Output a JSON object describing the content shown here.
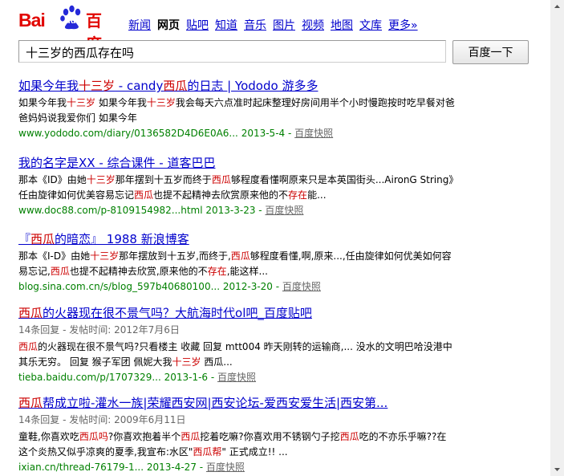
{
  "logo": {
    "bai": "Bai",
    "du": "du",
    "cn": "百度"
  },
  "nav": [
    {
      "label": "新闻",
      "current": false
    },
    {
      "label": "网页",
      "current": true
    },
    {
      "label": "贴吧",
      "current": false
    },
    {
      "label": "知道",
      "current": false
    },
    {
      "label": "音乐",
      "current": false
    },
    {
      "label": "图片",
      "current": false
    },
    {
      "label": "视频",
      "current": false
    },
    {
      "label": "地图",
      "current": false
    },
    {
      "label": "文库",
      "current": false
    },
    {
      "label": "更多»",
      "current": false
    }
  ],
  "search": {
    "value": "十三岁的西瓜存在吗",
    "button": "百度一下"
  },
  "results": [
    {
      "title": [
        [
          "如果今年我",
          false
        ],
        [
          "十三岁",
          true
        ],
        [
          " - candy",
          false
        ],
        [
          "西瓜",
          true
        ],
        [
          "的日志 | Yododo 游多多",
          false
        ]
      ],
      "abstract": [
        [
          "如果今年我",
          false
        ],
        [
          "十三岁",
          true
        ],
        [
          " 如果今年我",
          false
        ],
        [
          "十三岁",
          true
        ],
        [
          "我会每天六点准时起床整理好房间用半个小时慢跑按时吃早餐对爸爸妈妈说我爱你们 如果今年",
          false
        ]
      ],
      "meta": "",
      "url": "www.yododo.com/diary/0136582D4D6E0A6... 2013-5-4 - ",
      "snapshot": "百度快照"
    },
    {
      "title": [
        [
          "我的名字是XX - 综合课件 - 道客巴巴",
          false
        ]
      ],
      "abstract": [
        [
          "那本《ID》由她",
          false
        ],
        [
          "十三岁",
          true
        ],
        [
          "那年摆到十五岁而终于",
          false
        ],
        [
          "西瓜",
          true
        ],
        [
          "够程度看懂啊原来只是本英国街头...AironG String》任由旋律如何优美容易忘记",
          false
        ],
        [
          "西瓜",
          true
        ],
        [
          "也提不起精神去欣赏原来他的不",
          false
        ],
        [
          "存在",
          true
        ],
        [
          "能...",
          false
        ]
      ],
      "meta": "",
      "url": "www.doc88.com/p-8109154982...html 2013-3-23 - ",
      "snapshot": "百度快照"
    },
    {
      "title": [
        [
          "『",
          false
        ],
        [
          "西瓜",
          true
        ],
        [
          "的暗恋』 1988 新浪博客",
          false
        ]
      ],
      "abstract": [
        [
          "那本《I-D》由她",
          false
        ],
        [
          "十三岁",
          true
        ],
        [
          "那年摆放到十五岁,而终于,",
          false
        ],
        [
          "西瓜",
          true
        ],
        [
          "够程度看懂,啊,原来...,任由旋律如何优美如何容易忘记,",
          false
        ],
        [
          "西瓜",
          true
        ],
        [
          "也提不起精神去欣赏,原来他的不",
          false
        ],
        [
          "存在",
          true
        ],
        [
          ",能这样...",
          false
        ]
      ],
      "meta": "",
      "url": "blog.sina.com.cn/s/blog_597b40680100... 2012-3-20 - ",
      "snapshot": "百度快照"
    },
    {
      "title": [
        [
          "西瓜",
          true
        ],
        [
          "的火器现在很不景气吗？大航海时代ol吧_百度贴吧",
          false
        ]
      ],
      "abstract": [
        [
          "西瓜",
          true
        ],
        [
          "的火器现在很不景气吗?只看楼主 收藏 回复 mtt004 昨天刚转的运输商,... 没水的文明巴哈没港中 其乐无穷。 回复 猴子军团 佩妮大我",
          false
        ],
        [
          "十三岁",
          true
        ],
        [
          " 西瓜...",
          false
        ]
      ],
      "meta": "14条回复 - 发帖时间: 2012年7月6日",
      "url": "tieba.baidu.com/p/1707329... 2013-1-6 - ",
      "snapshot": "百度快照"
    },
    {
      "title": [
        [
          "西瓜",
          true
        ],
        [
          "帮成立啦-灌水一族|荣耀西安网|西安论坛-爱西安爱生活|西安第...",
          false
        ]
      ],
      "abstract": [
        [
          "童鞋,你喜欢吃",
          false
        ],
        [
          "西瓜吗",
          true
        ],
        [
          "?你喜欢抱着半个",
          false
        ],
        [
          "西瓜",
          true
        ],
        [
          "挖着吃嘛?你喜欢用不锈钢勺子挖",
          false
        ],
        [
          "西瓜",
          true
        ],
        [
          "吃的不亦乐乎嘛??在这个炎热又似乎凉爽的夏季,我宣布:水区\"",
          false
        ],
        [
          "西瓜帮",
          true
        ],
        [
          "\" 正式成立!! ...",
          false
        ]
      ],
      "meta": "14条回复 - 发帖时间: 2009年6月11日",
      "url": "ixian.cn/thread-76179-1... 2013-4-27 - ",
      "snapshot": "百度快照"
    }
  ]
}
